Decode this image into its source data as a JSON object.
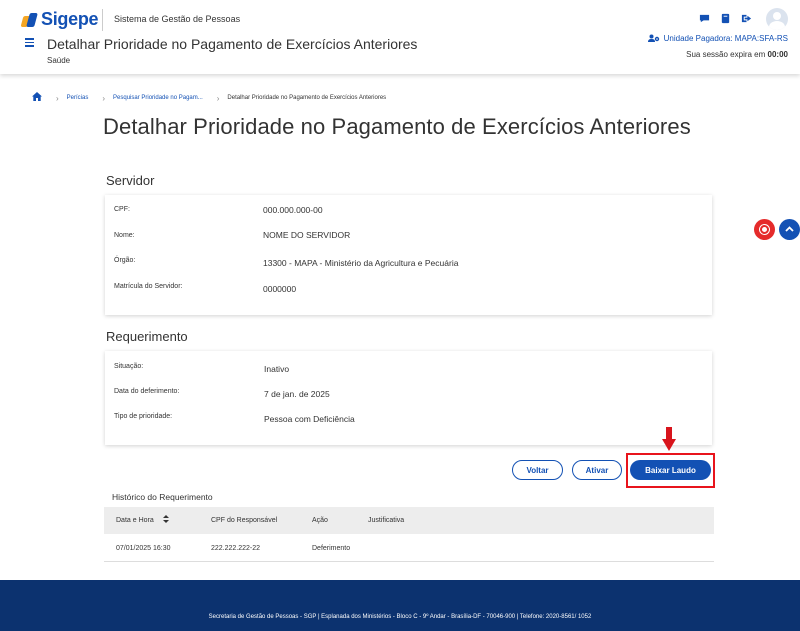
{
  "header": {
    "logo_text": "Sigepe",
    "system_name": "Sistema de Gestão de Pessoas",
    "title": "Detalhar Prioridade no Pagamento de Exercícios Anteriores",
    "subtitle": "Saúde",
    "unit": "Unidade Pagadora: MAPA:SFA-RS",
    "session_prefix": "Sua sessão expira em",
    "session_time": "00:00",
    "icons": [
      "chat-icon",
      "book-icon",
      "logout-icon"
    ]
  },
  "breadcrumb": {
    "items": [
      "Perícias",
      "Pesquisar Prioridade no Pagam...",
      "Detalhar Prioridade no Pagamento de Exercícios Anteriores"
    ]
  },
  "page_title": "Detalhar Prioridade no Pagamento de Exercícios Anteriores",
  "servidor": {
    "title": "Servidor",
    "fields": [
      {
        "label": "CPF:",
        "value": "000.000.000-00"
      },
      {
        "label": "Nome:",
        "value": "NOME DO SERVIDOR"
      },
      {
        "label": "Órgão:",
        "value": "13300 - MAPA - Ministério da Agricultura e Pecuária"
      },
      {
        "label": "Matrícula do Servidor:",
        "value": "0000000"
      }
    ]
  },
  "requerimento": {
    "title": "Requerimento",
    "fields": [
      {
        "label": "Situação:",
        "value": "Inativo"
      },
      {
        "label": "Data do deferimento:",
        "value": "7 de jan. de 2025"
      },
      {
        "label": "Tipo de prioridade:",
        "value": "Pessoa com Deficiência"
      }
    ]
  },
  "buttons": {
    "voltar": "Voltar",
    "ativar": "Ativar",
    "baixar": "Baixar Laudo"
  },
  "historico": {
    "title": "Histórico do Requerimento",
    "columns": [
      "Data e Hora",
      "CPF do Responsável",
      "Ação",
      "Justificativa"
    ],
    "rows": [
      [
        "07/01/2025 16:30",
        "222.222.222-22",
        "Deferimento",
        ""
      ]
    ]
  },
  "footer": {
    "text": "Secretaria de Gestão de Pessoas - SGP | Esplanada dos Ministérios - Bloco C - 9º Andar - Brasília-DF - 70046-900 | Telefone: 2020-8561/ 1052"
  },
  "colors": {
    "primary": "#1351b4",
    "footer": "#0c326f",
    "highlight": "#e8141c"
  }
}
